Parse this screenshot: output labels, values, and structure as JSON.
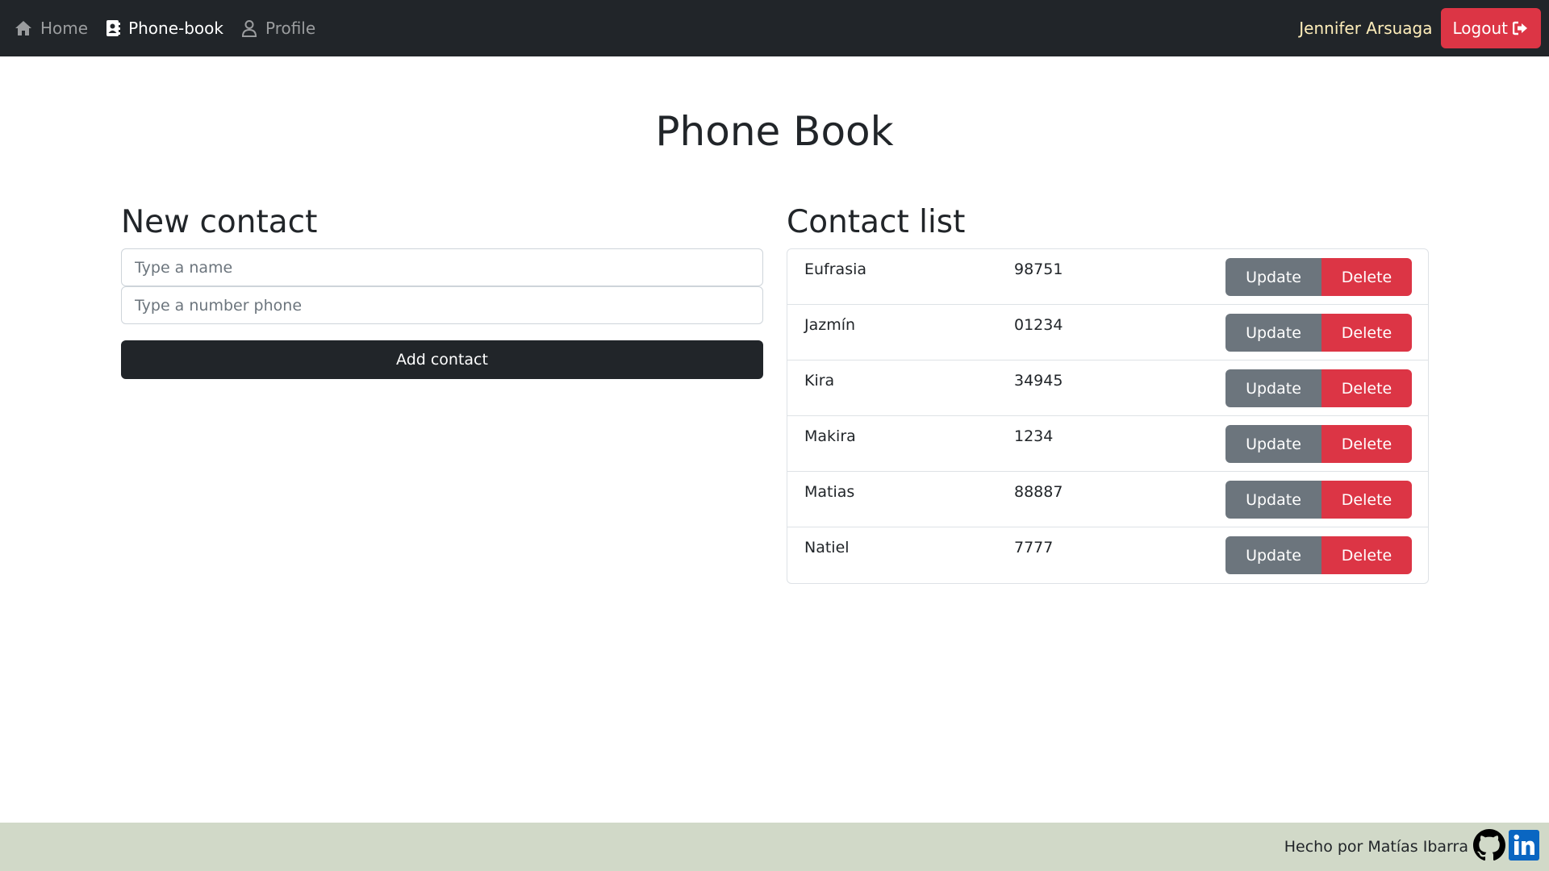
{
  "navbar": {
    "links": [
      {
        "label": "Home",
        "icon": "home-icon"
      },
      {
        "label": "Phone-book",
        "icon": "address-book-icon"
      },
      {
        "label": "Profile",
        "icon": "user-icon"
      }
    ],
    "user_name": "Jennifer Arsuaga",
    "logout_label": "Logout",
    "logout_icon": "sign-out-icon"
  },
  "main": {
    "title": "Phone Book"
  },
  "form": {
    "title": "New contact",
    "name_placeholder": "Type a name",
    "phone_placeholder": "Type a number phone",
    "name_value": "",
    "phone_value": "",
    "submit_label": "Add contact"
  },
  "contact_list": {
    "title": "Contact list",
    "update_label": "Update",
    "delete_label": "Delete",
    "contacts": [
      {
        "name": "Eufrasia",
        "phone": "98751"
      },
      {
        "name": "Jazmín",
        "phone": "01234"
      },
      {
        "name": "Kira",
        "phone": "34945"
      },
      {
        "name": "Makira",
        "phone": "1234"
      },
      {
        "name": "Matias",
        "phone": "88887"
      },
      {
        "name": "Natiel",
        "phone": "7777"
      }
    ]
  },
  "footer": {
    "credit": "Hecho por Matías Ibarra",
    "icons": [
      "github-icon",
      "linkedin-icon"
    ]
  },
  "colors": {
    "navbar_bg": "#212529",
    "user_name": "#ffeeba",
    "danger": "#dc3545",
    "secondary": "#6c757d",
    "footer_bg": "#d1d9c8",
    "linkedin": "#0a66c2"
  }
}
